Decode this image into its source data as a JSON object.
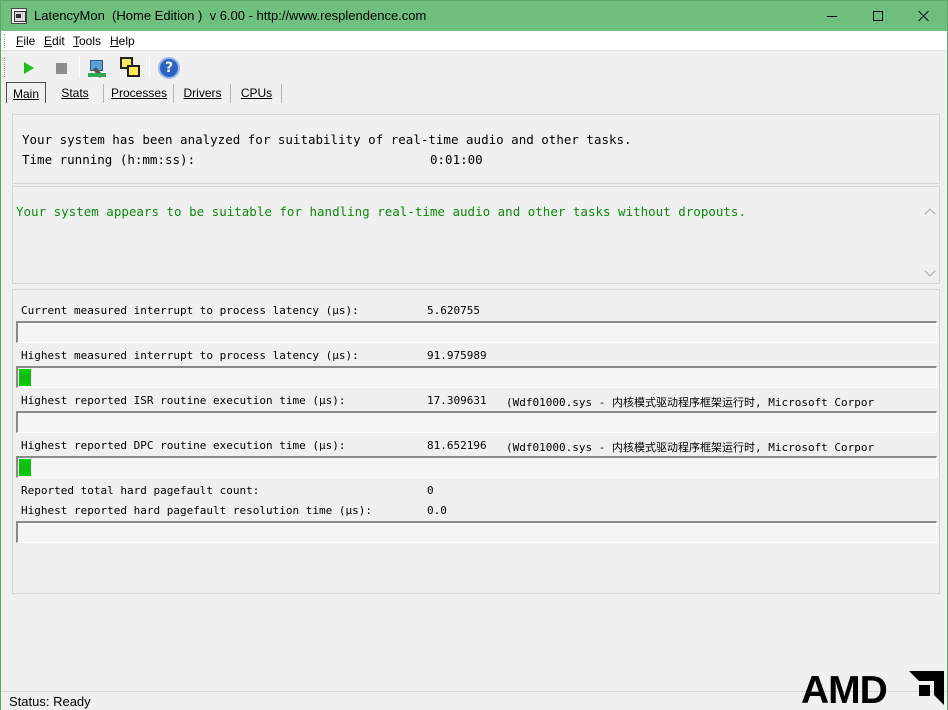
{
  "window": {
    "title": "LatencyMon  (Home Edition )  v 6.00 - http://www.resplendence.com"
  },
  "menu": [
    "File",
    "Edit",
    "Tools",
    "Help"
  ],
  "toolbar": {
    "buttons": [
      "play-icon",
      "stop-icon",
      "tool-icon",
      "windows-icon",
      "help-icon"
    ]
  },
  "tabs": [
    "Main",
    "Stats",
    "Processes",
    "Drivers",
    "CPUs"
  ],
  "info": {
    "line1": "Your system has been analyzed for suitability of real-time audio and other tasks.",
    "time_label": "Time running (h:mm:ss):",
    "time_value": "0:01:00"
  },
  "verdict": {
    "text": "Your system appears to be suitable for handling real-time audio and other tasks without dropouts.",
    "color": "#0a8a0a"
  },
  "metrics": [
    {
      "label": "Current measured interrupt to process latency (µs):",
      "value": "5.620755",
      "driver": "",
      "bar_level": 0.0
    },
    {
      "label": "Highest measured interrupt to process latency (µs):",
      "value": "91.975989",
      "driver": "",
      "bar_level": 0.013
    },
    {
      "label": "Highest reported ISR routine execution time (µs):",
      "value": "17.309631",
      "driver": "(Wdf01000.sys - 内核模式驱动程序框架运行时, Microsoft Corpor",
      "bar_level": 0.0
    },
    {
      "label": "Highest reported DPC routine execution time (µs):",
      "value": "81.652196",
      "driver": "(Wdf01000.sys - 内核模式驱动程序框架运行时, Microsoft Corpor",
      "bar_level": 0.013
    }
  ],
  "pagefaults": {
    "count_label": "Reported total hard pagefault count:",
    "count_value": "0",
    "time_label": "Highest reported hard pagefault resolution time (µs):",
    "time_value": "0.0",
    "bar_level": 0.0
  },
  "status": "Status: Ready",
  "logo": "AMD",
  "colors": {
    "titlebar": "#6fc07f",
    "bar_fill": "#11b711"
  }
}
